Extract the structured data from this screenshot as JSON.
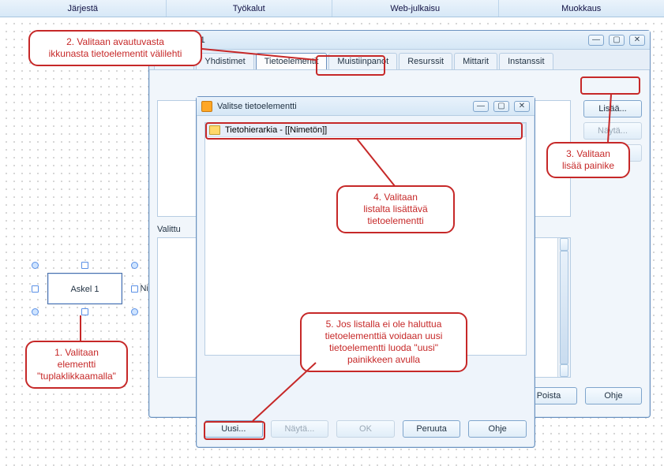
{
  "menu": {
    "jarjesta": "Järjestä",
    "tyokalut": "Työkalut",
    "webjulkaisu": "Web-julkaisu",
    "muokkaus": "Muokkaus"
  },
  "parent_dialog": {
    "title_suffix": "skel - Askel 1",
    "tabs": {
      "ehdot": "tukset",
      "yhdistimet": "Yhdistimet",
      "tietoelementit": "Tietoelementit",
      "muistiinpanot": "Muistiinpanot",
      "resurssit": "Resurssit",
      "mittarit": "Mittarit",
      "instanssit": "Instanssit"
    },
    "side_buttons": {
      "add": "Lisää...",
      "show": "Näytä...",
      "paste": "Poista"
    },
    "valittu_label": "Valittu",
    "bottom_buttons": {
      "delete": "Poista",
      "help": "Ohje"
    }
  },
  "child_dialog": {
    "title": "Valitse tietoelementti",
    "tree_item": "Tietohierarkia - [[Nimetön]]",
    "buttons": {
      "uusi": "Uusi...",
      "nayta": "Näytä...",
      "ok": "OK",
      "peruuta": "Peruuta",
      "ohje": "Ohje"
    }
  },
  "diagram": {
    "node_label": "Askel 1",
    "side_label": "Nim"
  },
  "callouts": {
    "c1": "1. Valitaan\nelementti\n\"tuplaklikkaamalla\"",
    "c2": "2. Valitaan avautuvasta\nikkunasta tietoelementit välilehti",
    "c3": "3. Valitaan\nlisää painike",
    "c4": "4. Valitaan\nlistalta lisättävä\ntietoelementti",
    "c5": "5. Jos listalla ei ole haluttua\ntietoelementtiä voidaan uusi\ntietoelementti luoda \"uusi\"\npainikkeen avulla"
  }
}
